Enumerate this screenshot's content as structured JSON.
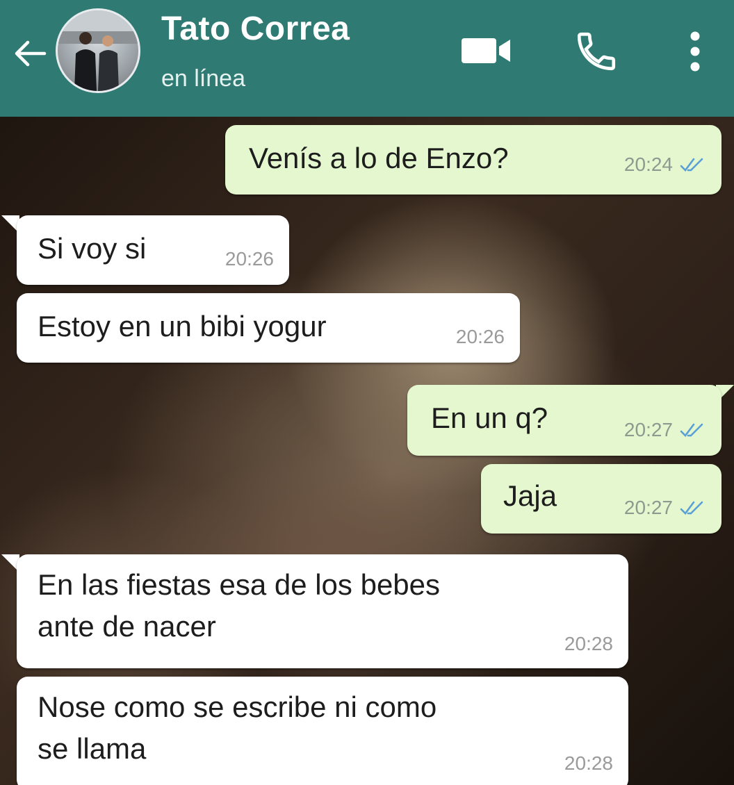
{
  "header": {
    "contact_name": "Tato Correa",
    "status": "en línea",
    "icons": {
      "back": "arrow-left-icon",
      "video": "video-camera-icon",
      "call": "phone-icon",
      "menu": "more-vertical-icon"
    },
    "color": "#2f7b73"
  },
  "messages": [
    {
      "direction": "out",
      "text": "Venís a lo de Enzo?",
      "time": "20:24",
      "status": "read"
    },
    {
      "direction": "in",
      "text": "Si voy si",
      "time": "20:26"
    },
    {
      "direction": "in",
      "text": "Estoy en un bibi yogur",
      "time": "20:26"
    },
    {
      "direction": "out",
      "text": "En un q?",
      "time": "20:27",
      "status": "read"
    },
    {
      "direction": "out",
      "text": "Jaja",
      "time": "20:27",
      "status": "read"
    },
    {
      "direction": "in",
      "text": "En las fiestas esa de los bebes\nante de nacer",
      "time": "20:28"
    },
    {
      "direction": "in",
      "text": "Nose como se escribe ni como\nse llama",
      "time": "20:28"
    }
  ],
  "colors": {
    "outgoing_bubble": "#e4f7cf",
    "incoming_bubble": "#ffffff",
    "read_ticks": "#5a9fd6"
  }
}
